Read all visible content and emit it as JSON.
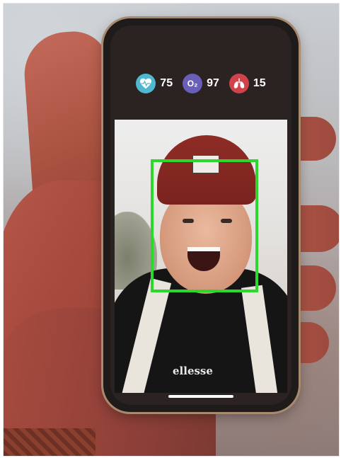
{
  "vitals": [
    {
      "name": "heart-rate",
      "icon": "heart-pulse-icon",
      "value": "75",
      "color": "#4fb8cf"
    },
    {
      "name": "oxygen",
      "icon": "oxygen-o2-icon",
      "value": "97",
      "color": "#6a5fb8",
      "icon_text": "O₂"
    },
    {
      "name": "respiration",
      "icon": "lungs-icon",
      "value": "15",
      "color": "#d1434a"
    }
  ],
  "camera": {
    "face_detected": true,
    "box_color": "#2bd82b",
    "jacket_brand": "ellesse"
  }
}
